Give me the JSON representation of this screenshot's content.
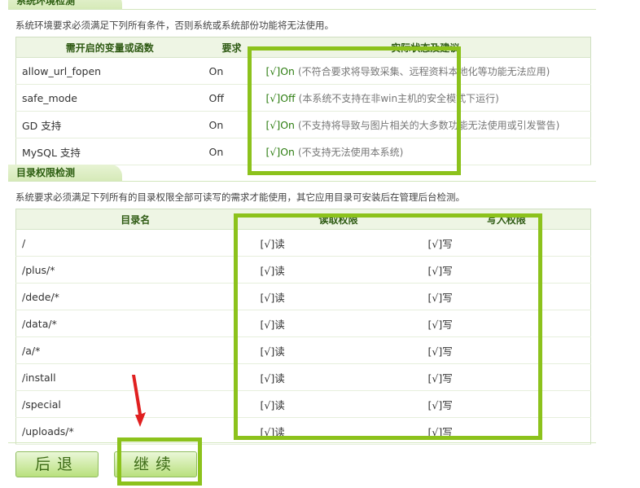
{
  "env_check": {
    "title": "系统环境检测",
    "desc": "系统环境要求必须满足下列所有条件，否则系统或系统部份功能将无法使用。",
    "headers": [
      "需开启的变量或函数",
      "要求",
      "实际状态及建议"
    ],
    "rows": [
      {
        "name": "allow_url_fopen",
        "req": "On",
        "status": "[√]On",
        "note": "(不符合要求将导致采集、远程资料本地化等功能无法应用)"
      },
      {
        "name": "safe_mode",
        "req": "Off",
        "status": "[√]Off",
        "note": "(本系统不支持在非win主机的安全模式下运行)"
      },
      {
        "name": "GD 支持",
        "req": "On",
        "status": "[√]On",
        "note": "(不支持将导致与图片相关的大多数功能无法使用或引发警告)"
      },
      {
        "name": "MySQL 支持",
        "req": "On",
        "status": "[√]On",
        "note": "(不支持无法使用本系统)"
      }
    ]
  },
  "dir_check": {
    "title": "目录权限检测",
    "desc": "系统要求必须满足下列所有的目录权限全部可读写的需求才能使用，其它应用目录可安装后在管理后台检测。",
    "headers": [
      "目录名",
      "读取权限",
      "写入权限"
    ],
    "rows": [
      {
        "dir": "/",
        "read": "[√]读",
        "write": "[√]写"
      },
      {
        "dir": "/plus/*",
        "read": "[√]读",
        "write": "[√]写"
      },
      {
        "dir": "/dede/*",
        "read": "[√]读",
        "write": "[√]写"
      },
      {
        "dir": "/data/*",
        "read": "[√]读",
        "write": "[√]写"
      },
      {
        "dir": "/a/*",
        "read": "[√]读",
        "write": "[√]写"
      },
      {
        "dir": "/install",
        "read": "[√]读",
        "write": "[√]写"
      },
      {
        "dir": "/special",
        "read": "[√]读",
        "write": "[√]写"
      },
      {
        "dir": "/uploads/*",
        "read": "[√]读",
        "write": "[√]写"
      }
    ]
  },
  "buttons": {
    "back": "后退",
    "continue": "继续"
  },
  "colors": {
    "highlight": "#8cc21c",
    "arrow": "#e02020",
    "ok_text": "#2d7d11"
  }
}
